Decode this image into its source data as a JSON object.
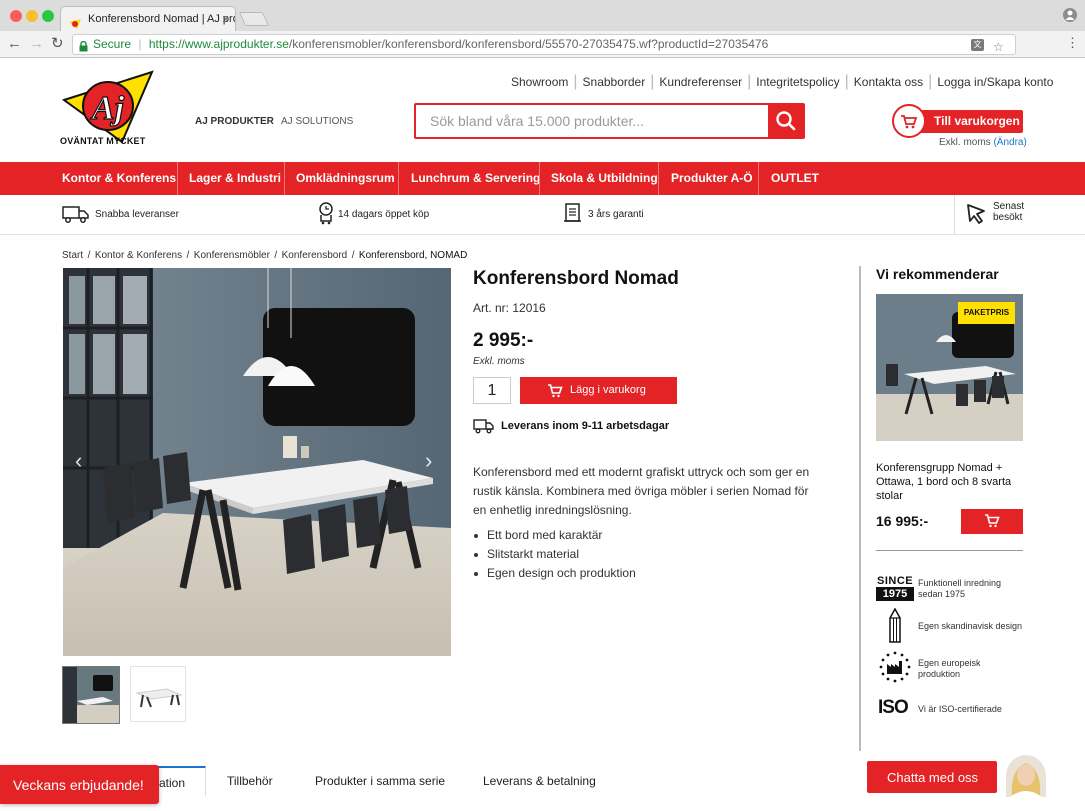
{
  "browser": {
    "tab_title": "Konferensbord Nomad | AJ pro",
    "tab_close": "×",
    "secure_label": "Secure",
    "url_domain": "https://www.ajprodukter.se",
    "url_path": "/konferensmobler/konferensbord/konferensbord/55570-27035475.wf?productId=27035476"
  },
  "header": {
    "logo_text": "AJ",
    "logo_tagline": "OVÄNTAT MYCKET",
    "tabs": [
      {
        "label": "AJ PRODUKTER"
      },
      {
        "label": "AJ SOLUTIONS"
      }
    ],
    "top_links": [
      {
        "label": "Showroom"
      },
      {
        "label": "Snabborder"
      },
      {
        "label": "Kundreferenser"
      },
      {
        "label": "Integritetspolicy"
      },
      {
        "label": "Kontakta oss"
      },
      {
        "label": "Logga in/Skapa konto"
      }
    ],
    "search_placeholder": "Sök bland våra 15.000 produkter...",
    "cart_label": "Till varukorgen",
    "vat_label": "Exkl. moms",
    "vat_change": "(Ändra)"
  },
  "nav": {
    "items": [
      {
        "label": "Kontor & Konferens"
      },
      {
        "label": "Lager & Industri"
      },
      {
        "label": "Omklädningsrum"
      },
      {
        "label": "Lunchrum & Servering"
      },
      {
        "label": "Skola & Utbildning"
      },
      {
        "label": "Produkter A-Ö"
      },
      {
        "label": "OUTLET"
      }
    ]
  },
  "usp": {
    "items": [
      {
        "label": "Snabba leveranser"
      },
      {
        "label": "14 dagars öppet köp"
      },
      {
        "label": "3 års garanti"
      }
    ],
    "recent_line1": "Senast",
    "recent_line2": "besökt"
  },
  "breadcrumb": {
    "items": [
      {
        "label": "Start"
      },
      {
        "label": "Kontor & Konferens"
      },
      {
        "label": "Konferensmöbler"
      },
      {
        "label": "Konferensbord"
      },
      {
        "label": "Konferensbord, NOMAD"
      }
    ],
    "separator": "/"
  },
  "product": {
    "title": "Konferensbord Nomad",
    "art_label": "Art. nr: 12016",
    "price": "2 995:-",
    "price_note": "Exkl. moms",
    "quantity": "1",
    "add_to_cart": "Lägg i varukorg",
    "delivery": "Leverans inom 9-11 arbetsdagar",
    "description": "Konferensbord med ett modernt grafiskt uttryck och som ger en rustik känsla. Kombinera med övriga möbler i serien Nomad för en enhetlig inredningslösning.",
    "bullets": [
      {
        "text": "Ett bord med karaktär"
      },
      {
        "text": "Slitstarkt material"
      },
      {
        "text": "Egen design och produktion"
      }
    ]
  },
  "recommend": {
    "heading": "Vi rekommenderar",
    "badge": "PAKETPRIS",
    "name": "Konferensgrupp Nomad + Ottawa, 1 bord och 8 svarta stolar",
    "price": "16 995:-"
  },
  "features": [
    {
      "line1": "Funktionell inredning",
      "line2": "sedan 1975",
      "icon_text1": "SINCE",
      "icon_text2": "1975"
    },
    {
      "line1": "Egen skandinavisk design",
      "line2": ""
    },
    {
      "line1": "Egen europeisk",
      "line2": "produktion"
    },
    {
      "line1": "Vi är ISO-certifierade",
      "line2": "",
      "icon_text1": "ISO"
    }
  ],
  "bottom_tabs": [
    {
      "label": "ation"
    },
    {
      "label": "Tillbehör"
    },
    {
      "label": "Produkter i samma serie"
    },
    {
      "label": "Leverans & betalning"
    }
  ],
  "popups": {
    "offers": "Veckans erbjudande!",
    "chat": "Chatta med oss"
  },
  "colors": {
    "brand_red": "#e32325",
    "logo_yellow": "#ffe000",
    "link_blue": "#1a76c9"
  }
}
